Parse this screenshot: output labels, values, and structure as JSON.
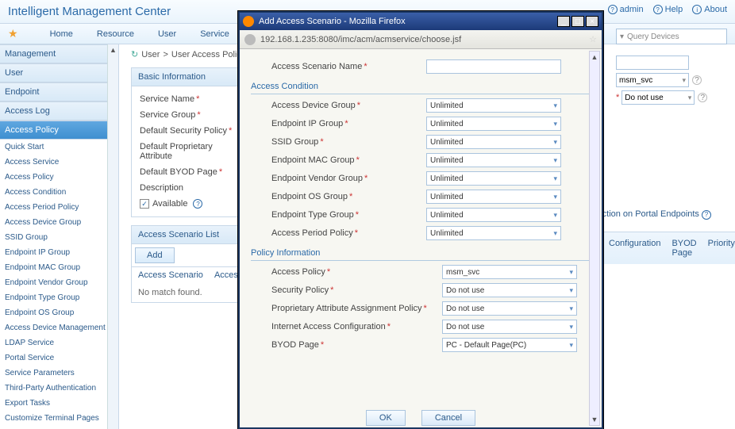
{
  "header": {
    "title": "Intelligent Management Center",
    "admin": "admin",
    "help": "Help",
    "about": "About"
  },
  "nav": {
    "items": [
      "Home",
      "Resource",
      "User",
      "Service"
    ],
    "query": "Query Devices"
  },
  "sidebar": {
    "management": "Management",
    "user": "User",
    "endpoint": "Endpoint",
    "accessLog": "Access Log",
    "accessPolicy": "Access Policy",
    "items": [
      "Quick Start",
      "Access Service",
      "Access Policy",
      "Access Condition",
      "Access Period Policy",
      "Access Device Group",
      "SSID Group",
      "Endpoint IP Group",
      "Endpoint MAC Group",
      "Endpoint Vendor Group",
      "Endpoint Type Group",
      "Endpoint OS Group",
      "Access Device Management",
      "LDAP Service",
      "Portal Service",
      "Service Parameters",
      "Third-Party Authentication",
      "Export Tasks",
      "Customize Terminal Pages"
    ]
  },
  "breadcrumb": {
    "a": "User",
    "b": "User Access Policy"
  },
  "basic": {
    "head": "Basic Information",
    "serviceName": "Service Name",
    "serviceGroup": "Service Group",
    "secPolicy": "Default Security Policy",
    "propAttr": "Default Proprietary Attribute",
    "byod": "Default BYOD Page",
    "desc": "Description",
    "avail": "Available"
  },
  "scenario": {
    "head": "Access Scenario List",
    "add": "Add",
    "col1": "Access Scenario",
    "col2": "Access",
    "empty": "No match found."
  },
  "right": {
    "msm": "msm_svc",
    "donot": "Do not use",
    "portal": "Action on Portal Endpoints"
  },
  "rtabs": {
    "a": "Configuration",
    "b": "BYOD Page",
    "c": "Priority"
  },
  "dlg": {
    "title": "Add Access Scenario - Mozilla Firefox",
    "url": "192.168.1.235:8080/imc/acm/acmservice/choose.jsf",
    "name": "Access Scenario Name",
    "sec1": "Access Condition",
    "devGroup": "Access Device Group",
    "ipGroup": "Endpoint IP Group",
    "ssid": "SSID Group",
    "mac": "Endpoint MAC Group",
    "vendor": "Endpoint Vendor Group",
    "os": "Endpoint OS Group",
    "type": "Endpoint Type Group",
    "period": "Access Period Policy",
    "unlimited": "Unlimited",
    "sec2": "Policy Information",
    "accessPol": "Access Policy",
    "securityPol": "Security Policy",
    "propPol": "Proprietary Attribute Assignment Policy",
    "inet": "Internet Access Configuration",
    "byodPage": "BYOD Page",
    "msm": "msm_svc",
    "donot": "Do not use",
    "pc": "PC - Default Page(PC)",
    "ok": "OK",
    "cancel": "Cancel"
  }
}
